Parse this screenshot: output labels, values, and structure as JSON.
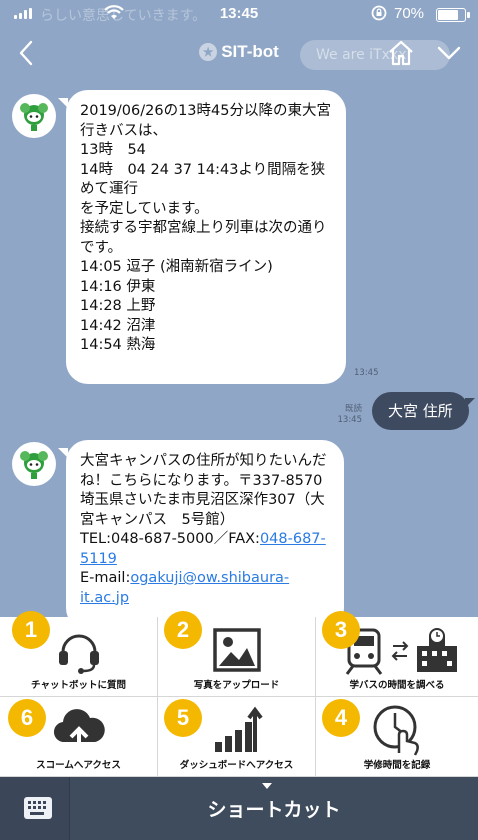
{
  "status_bar": {
    "time": "13:45",
    "battery_percent": "70%",
    "battery_level": 0.7,
    "ghost_text": "らしい意思していきます。"
  },
  "header": {
    "title": "SIT-bot",
    "ghost_text": "We are iTxxx"
  },
  "messages": {
    "bot1": {
      "text": "2019/06/26の13時45分以降の東大宮行きバスは、\n13時　54\n14時　04 24 37 14:43より間隔を狭めて運行\nを予定しています。\n接続する宇都宮線上り列車は次の通りです。\n14:05 逗子 (湘南新宿ライン)\n14:16 伊東\n14:28 上野\n14:42 沼津\n14:54 熱海",
      "time": "13:45"
    },
    "user1": {
      "text": "大宮 住所",
      "read": "既読",
      "time": "13:45"
    },
    "bot2": {
      "text_before": "大宮キャンパスの住所が知りたいんだね！こちらになります。〒337-8570　埼玉県さいたま市見沼区深作307（大宮キャンパス　5号館）\nTEL:048-687-5000／FAX:",
      "fax": "048-687-5119",
      "email_label": "\nE-mail:",
      "email": "ogakuji@ow.shibaura-it.ac.jp"
    }
  },
  "shortcuts": [
    {
      "number": "1",
      "label": "チャットボットに質問",
      "icon": "headset-icon"
    },
    {
      "number": "2",
      "label": "写真をアップロード",
      "icon": "image-icon"
    },
    {
      "number": "3",
      "label": "学バスの時間を調べる",
      "icon": "train-building-icon"
    },
    {
      "number": "6",
      "label": "スコームへアクセス",
      "icon": "cloud-upload-icon"
    },
    {
      "number": "5",
      "label": "ダッシュボードへアクセス",
      "icon": "bar-chart-icon"
    },
    {
      "number": "4",
      "label": "学修時間を記録",
      "icon": "clock-hand-icon"
    }
  ],
  "bottom_bar": {
    "label": "ショートカット"
  },
  "colors": {
    "chat_background": "#8fa6c6",
    "badge": "#f5b800",
    "user_bubble": "#3d4a5f",
    "bottom_bar": "#3f4c5e",
    "link": "#2a7be4"
  }
}
